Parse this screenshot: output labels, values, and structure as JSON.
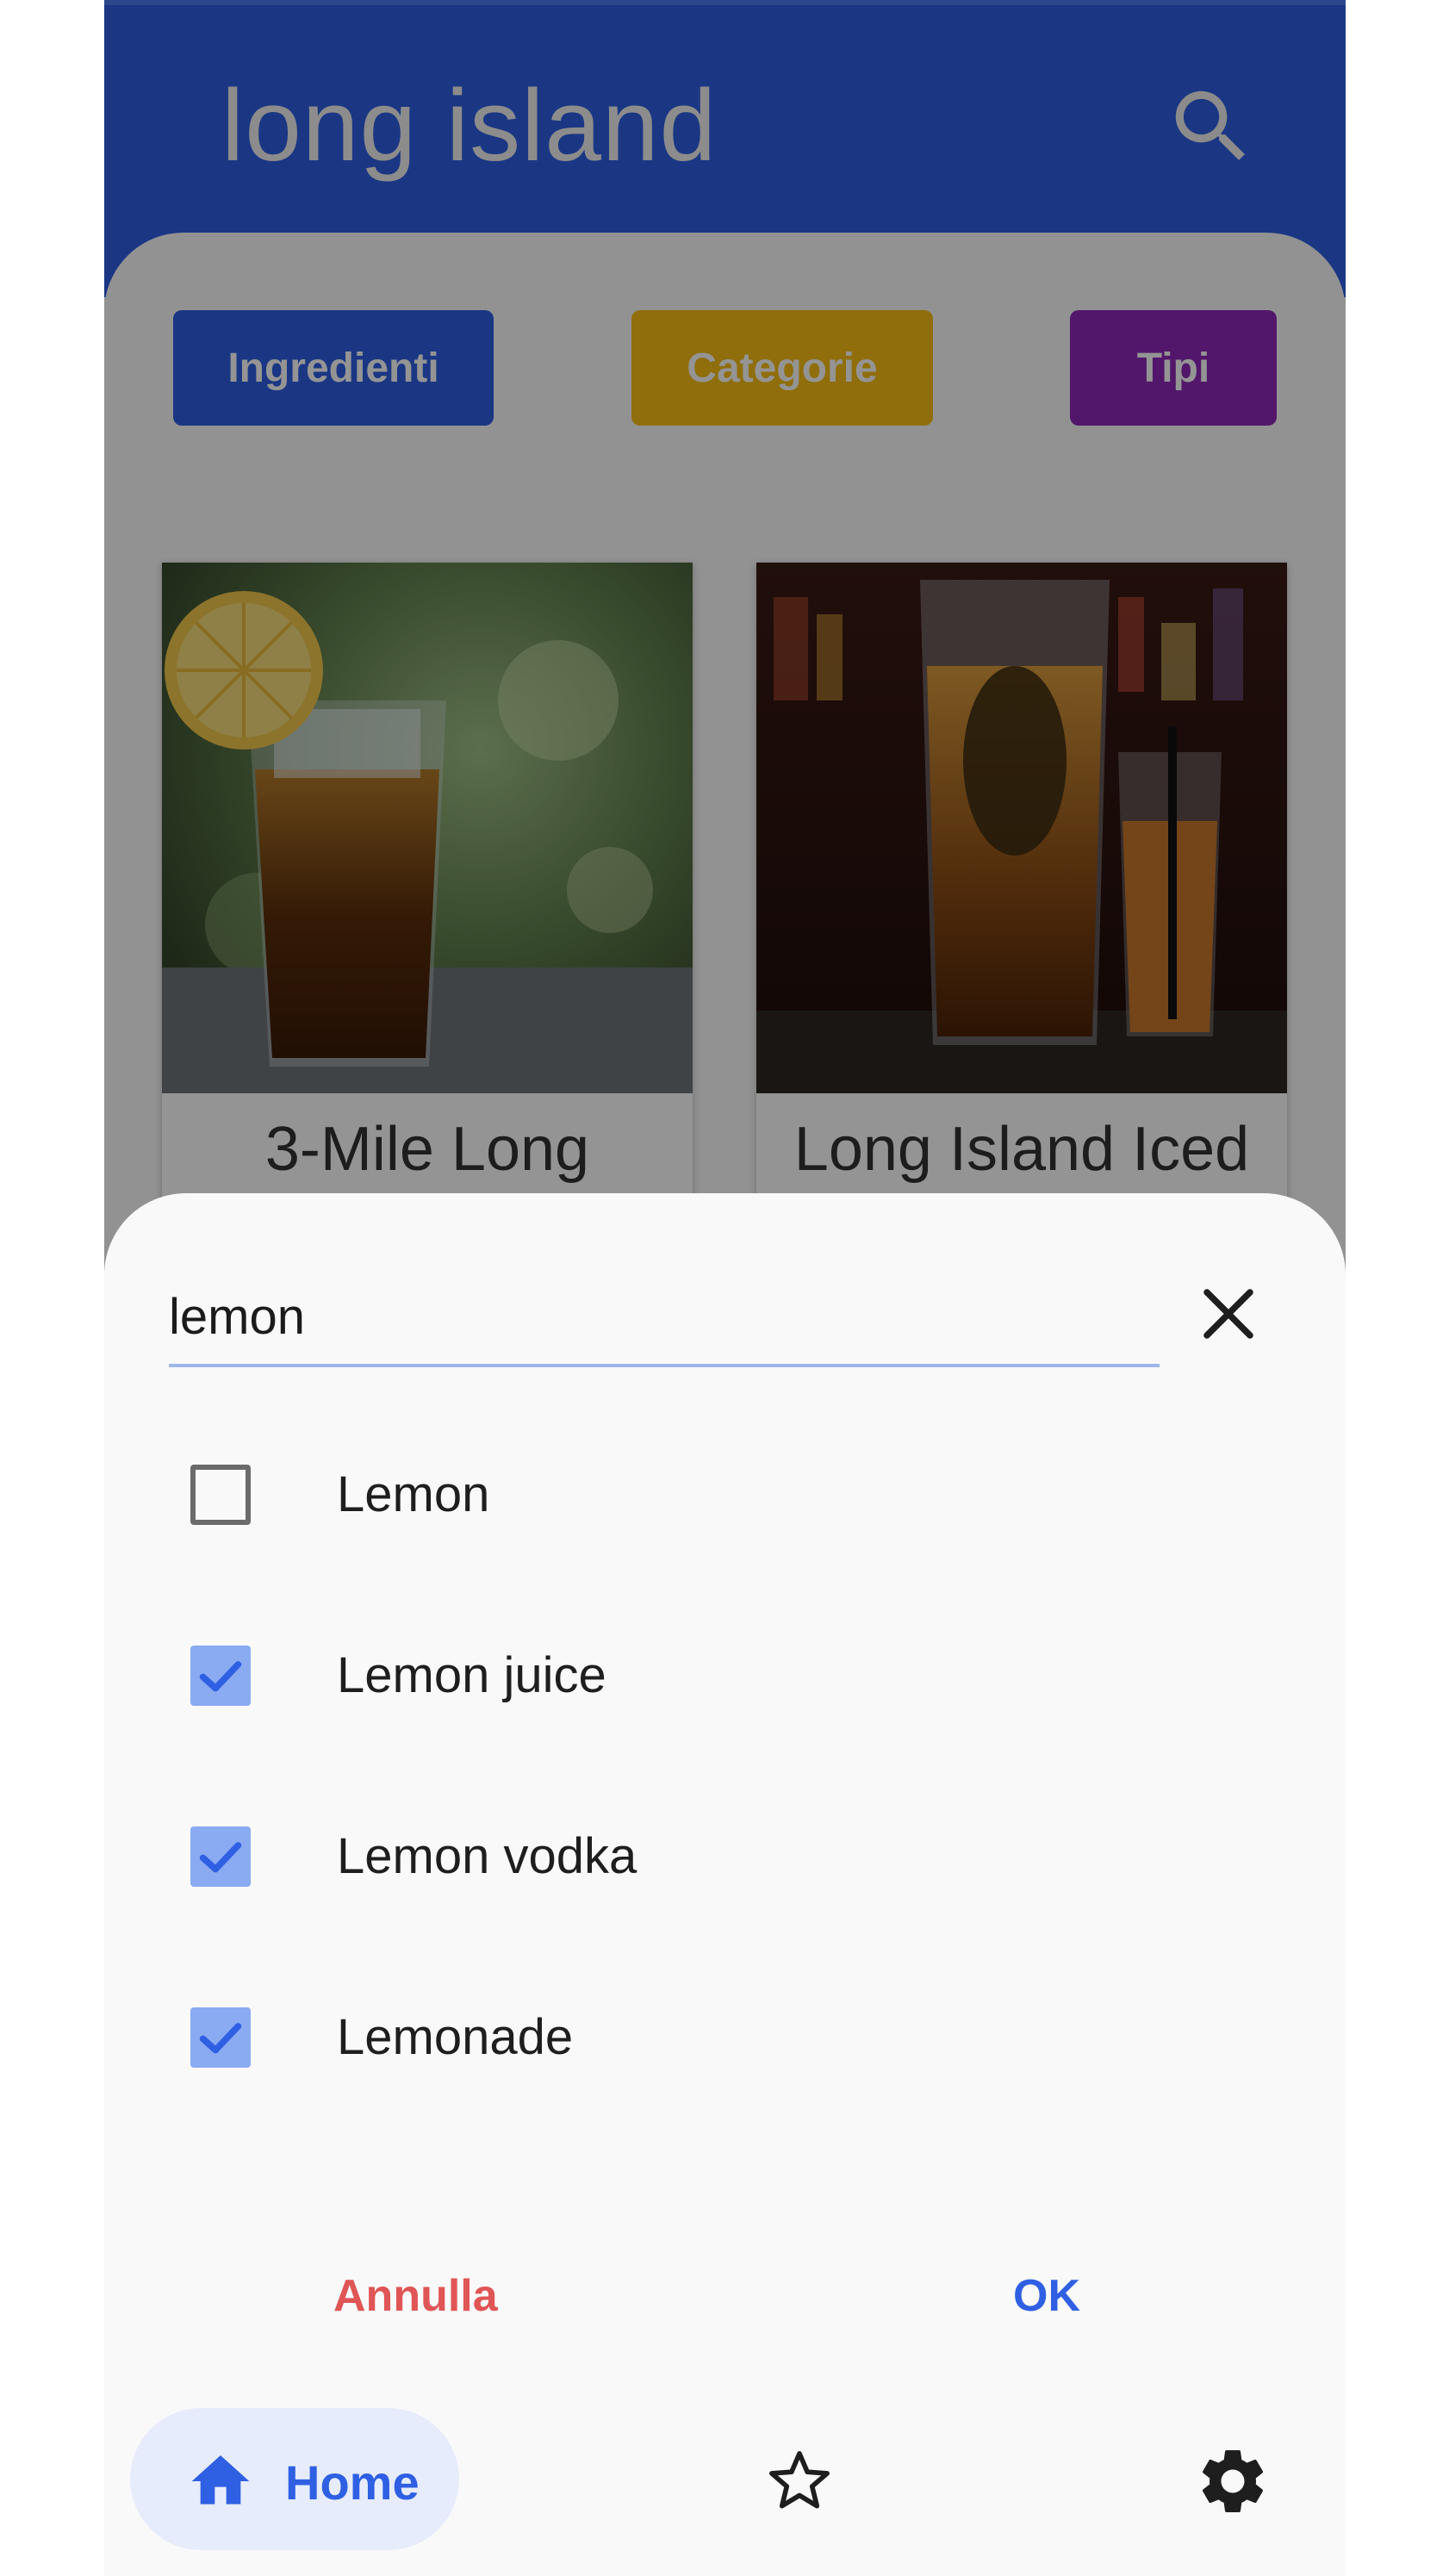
{
  "header": {
    "title": "long island",
    "search_icon": "search-icon"
  },
  "filters": {
    "ingredients_label": "Ingredienti",
    "categories_label": "Categorie",
    "types_label": "Tipi"
  },
  "cards": [
    {
      "title": "3-Mile Long"
    },
    {
      "title": "Long Island Iced"
    }
  ],
  "sheet": {
    "search_value": "lemon",
    "options": [
      {
        "label": "Lemon",
        "checked": false
      },
      {
        "label": "Lemon juice",
        "checked": true
      },
      {
        "label": "Lemon vodka",
        "checked": true
      },
      {
        "label": "Lemonade",
        "checked": true
      }
    ],
    "cancel_label": "Annulla",
    "ok_label": "OK"
  },
  "nav": {
    "home_label": "Home"
  },
  "colors": {
    "primary": "#2f5fe3",
    "categories": "#f6bd14",
    "types": "#8e29b8",
    "cancel": "#e05555",
    "checkbox_checked": "#8aaaf2"
  }
}
